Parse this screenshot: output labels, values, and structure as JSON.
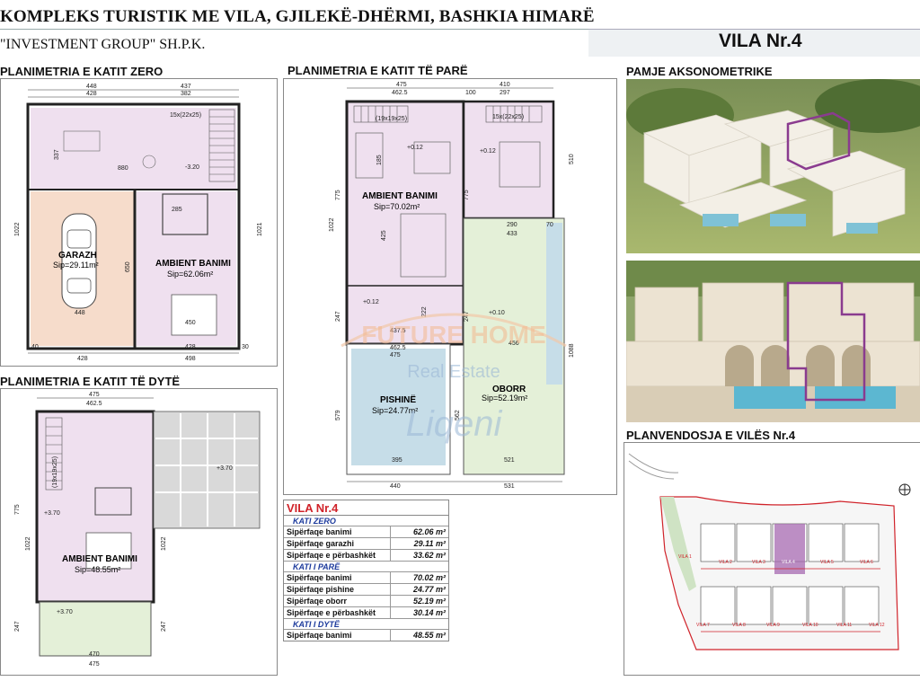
{
  "header": {
    "title": "KOMPLEKS TURISTIK ME VILA, GJILEKË-DHËRMI, BASHKIA HIMARË",
    "subtitle": "\"INVESTMENT GROUP\" SH.P.K.",
    "villa": "VILA Nr.4"
  },
  "sections": {
    "ground": "PLANIMETRIA E KATIT ZERO",
    "first": "PLANIMETRIA E KATIT TË PARË",
    "second": "PLANIMETRIA E KATIT TË DYTË",
    "axon": "PAMJE AKSONOMETRIKE",
    "site": "PLANVENDOSJA E VILËS Nr.4"
  },
  "ground_plan": {
    "garage_name": "GARAZH",
    "garage_area": "Sip=29.11m²",
    "living_name": "AMBIENT BANIMI",
    "living_area": "Sip=62.06m²",
    "stairs": "15x(22x25)",
    "level": "-3.20",
    "dims": {
      "w1": "448",
      "w2": "428",
      "w3": "437",
      "w4": "382",
      "h1": "1022",
      "h2": "1021",
      "b1": "428",
      "b2": "428",
      "b3": "498",
      "d880": "880",
      "d650": "650",
      "d337": "337",
      "d285": "285",
      "d450": "450",
      "d448": "448",
      "d30": "30",
      "d40": "40"
    }
  },
  "first_plan": {
    "living_name": "AMBIENT BANIMI",
    "living_area": "Sip=70.02m²",
    "pool_name": "PISHINË",
    "pool_area": "Sip=24.77m²",
    "yard_name": "OBORR",
    "yard_area": "Sip=52.19m²",
    "stairs_a": "(19x19x25)",
    "stairs_b": "15x(22x25)",
    "level_a": "+0.12",
    "level_b": "+0.12",
    "level_c": "+0.10",
    "level_d": "+0.12",
    "dims": {
      "w1": "475",
      "w2": "462.5",
      "w3": "410",
      "w4": "297",
      "w100": "100",
      "h1": "1022",
      "h2": "1088",
      "h775": "775",
      "h510": "510",
      "h425": "425",
      "h247": "247",
      "h222": "222",
      "h579": "579",
      "h562": "562",
      "d437": "437.5",
      "d462": "462.5",
      "d475": "475",
      "d456": "456",
      "d290": "290",
      "d433": "433",
      "d70": "70",
      "d395": "395",
      "d521": "521",
      "d440": "440",
      "d531": "531",
      "d185": "185"
    }
  },
  "second_plan": {
    "living_name": "AMBIENT BANIMI",
    "living_area": "Sip=48.55m²",
    "stairs": "(19x19x25)",
    "level_a": "+3.70",
    "level_b": "+3.70",
    "level_c": "+3.70",
    "dims": {
      "w1": "475",
      "w2": "462.5",
      "h1": "1022",
      "h775": "775",
      "h247": "247",
      "h1022b": "1022",
      "b470": "470",
      "b475": "475"
    }
  },
  "table": {
    "title": "VILA Nr.4",
    "sections": [
      {
        "name": "KATI ZERO",
        "rows": [
          {
            "k": "Sipërfaqe banimi",
            "v": "62.06 m²"
          },
          {
            "k": "Sipërfaqe garazhi",
            "v": "29.11 m²"
          },
          {
            "k": "Sipërfaqe e përbashkët",
            "v": "33.62 m²"
          }
        ]
      },
      {
        "name": "KATI I PARË",
        "rows": [
          {
            "k": "Sipërfaqe banimi",
            "v": "70.02 m²"
          },
          {
            "k": "Sipërfaqe pishine",
            "v": "24.77 m²"
          },
          {
            "k": "Sipërfaqe oborr",
            "v": "52.19 m²"
          },
          {
            "k": "Sipërfaqe e përbashkët",
            "v": "30.14 m²"
          }
        ]
      },
      {
        "name": "KATI I DYTË",
        "rows": [
          {
            "k": "Sipërfaqe banimi",
            "v": "48.55 m²"
          }
        ]
      }
    ]
  },
  "watermark": {
    "line1": "FUTURE HOME",
    "line2": "Real Estate",
    "line3": "Liqeni"
  },
  "site_plan": {
    "labels": [
      "VILA 1",
      "VILA 2",
      "VILA 3",
      "VILA 4",
      "VILA 5",
      "VILA 6",
      "VILA 7",
      "VILA 8",
      "VILA 9",
      "VILA 10",
      "VILA 11",
      "VILA 12"
    ]
  },
  "colors": {
    "garage": "#f6dccb",
    "living": "#efe0ef",
    "pool": "#c6dde8",
    "yard": "#e4f0d8",
    "highlight": "#8a3b8f",
    "red": "#d0232a",
    "blue": "#1c3a9c"
  }
}
